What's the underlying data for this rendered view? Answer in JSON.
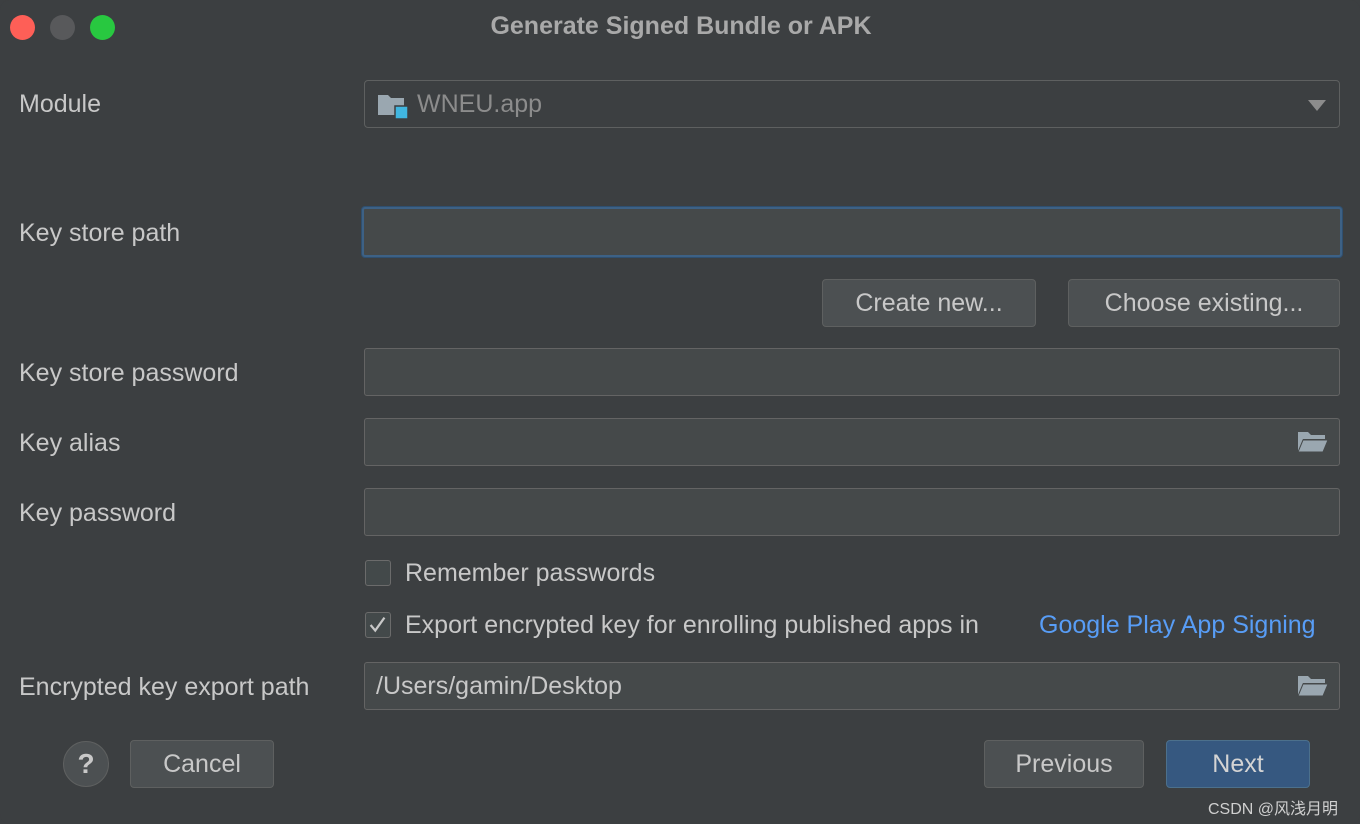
{
  "window": {
    "title": "Generate Signed Bundle or APK"
  },
  "module": {
    "label": "Module",
    "value": "WNEU.app"
  },
  "keystore": {
    "path_label": "Key store path",
    "path_value": "",
    "create_new_label": "Create new...",
    "choose_existing_label": "Choose existing...",
    "password_label": "Key store password",
    "password_value": ""
  },
  "key": {
    "alias_label": "Key alias",
    "alias_value": "",
    "password_label": "Key password",
    "password_value": ""
  },
  "options": {
    "remember_passwords_label": "Remember passwords",
    "remember_passwords_checked": false,
    "export_key_label": "Export encrypted key for enrolling published apps in",
    "export_key_link": "Google Play App Signing",
    "export_key_checked": true
  },
  "export_path": {
    "label": "Encrypted key export path",
    "value": "/Users/gamin/Desktop"
  },
  "footer": {
    "help_label": "?",
    "cancel_label": "Cancel",
    "previous_label": "Previous",
    "next_label": "Next"
  },
  "watermark": "CSDN @风浅月明",
  "colors": {
    "background": "#3c3f41",
    "link": "#589df6",
    "primary_button": "#365880",
    "focus_border": "#3d6185"
  },
  "icons": {
    "module": "module-folder-icon",
    "browse": "folder-open-icon",
    "dropdown": "chevron-down-icon",
    "check": "checkmark-icon"
  }
}
